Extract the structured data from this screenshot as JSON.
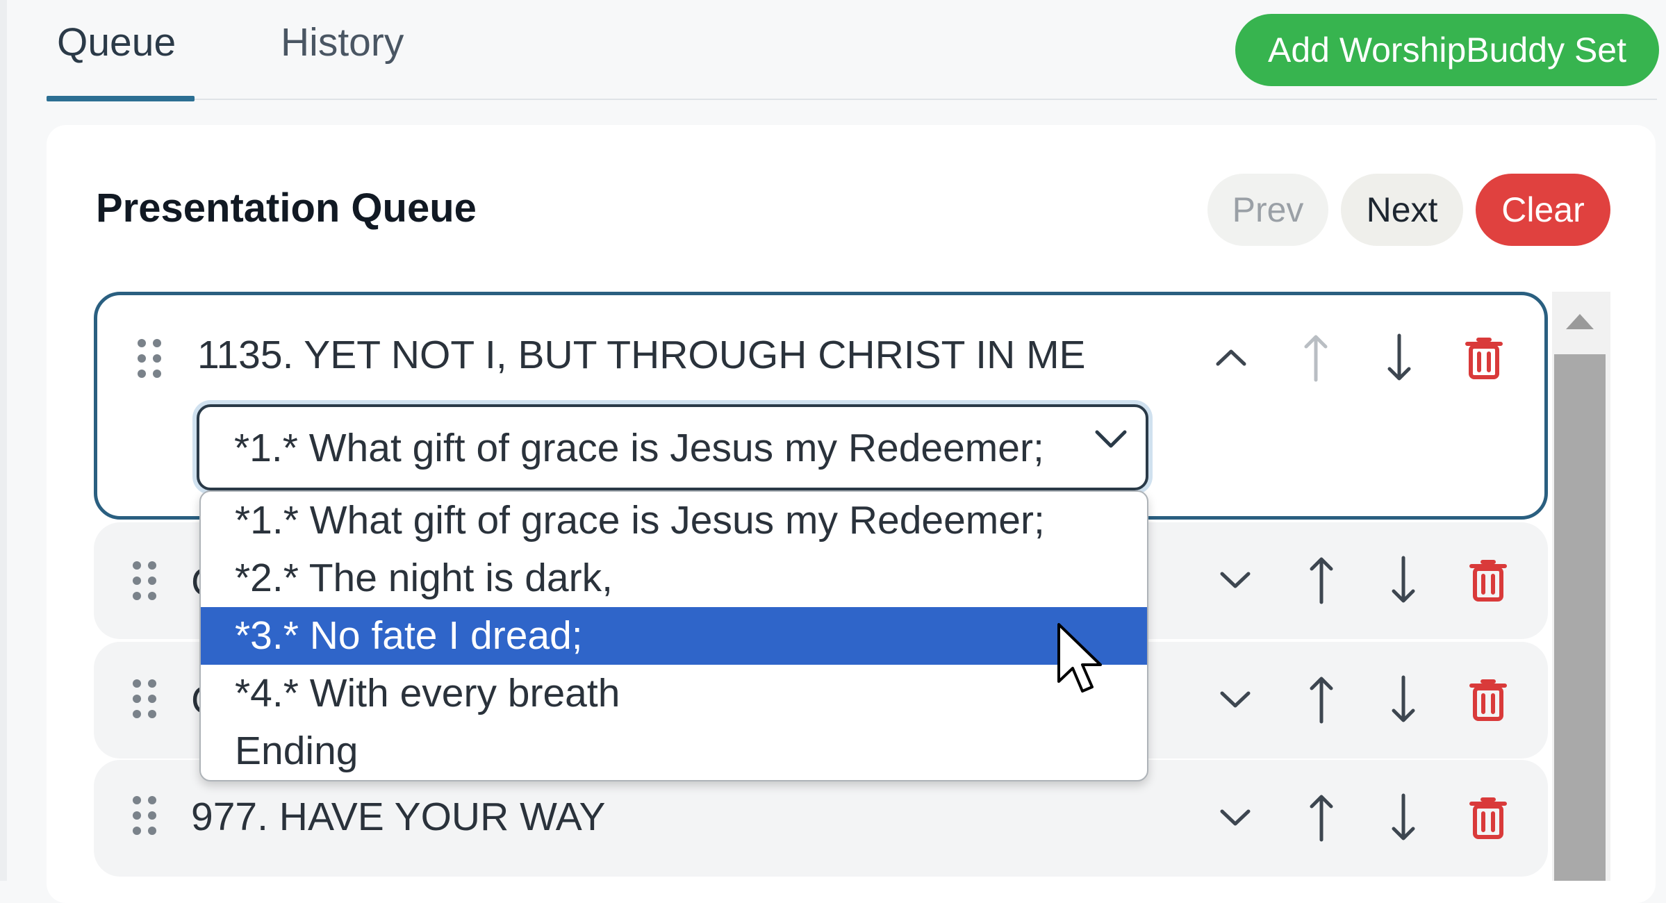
{
  "tabs": [
    {
      "label": "Queue",
      "active": true
    },
    {
      "label": "History",
      "active": false
    }
  ],
  "add_set_button": "Add WorshipBuddy Set",
  "queue": {
    "title": "Presentation Queue",
    "prev_label": "Prev",
    "next_label": "Next",
    "clear_label": "Clear",
    "items": [
      {
        "title": "1135. YET NOT I, BUT THROUGH CHRIST IN ME",
        "expanded": true
      },
      {
        "title": "C",
        "expanded": false
      },
      {
        "title": "C",
        "expanded": false
      },
      {
        "title": "977. HAVE YOUR WAY",
        "expanded": false
      }
    ],
    "verse_select": {
      "value": "*1.* What gift of grace is Jesus my Redeemer;",
      "options": [
        "*1.* What gift of grace is Jesus my Redeemer;",
        "*2.* The night is dark,",
        "*3.* No fate I dread;",
        "*4.* With every breath",
        "Ending"
      ],
      "highlighted_index": 2
    }
  },
  "colors": {
    "accent": "#2c6f93",
    "add_set": "#37b44f",
    "clear": "#e0413f",
    "highlight": "#2f65c9",
    "delete_icon": "#d93a3a"
  },
  "icons": [
    "drag-handle-icon",
    "chevron-up-icon",
    "chevron-down-icon",
    "arrow-up-icon",
    "arrow-down-icon",
    "trash-icon",
    "mouse-cursor-icon"
  ]
}
